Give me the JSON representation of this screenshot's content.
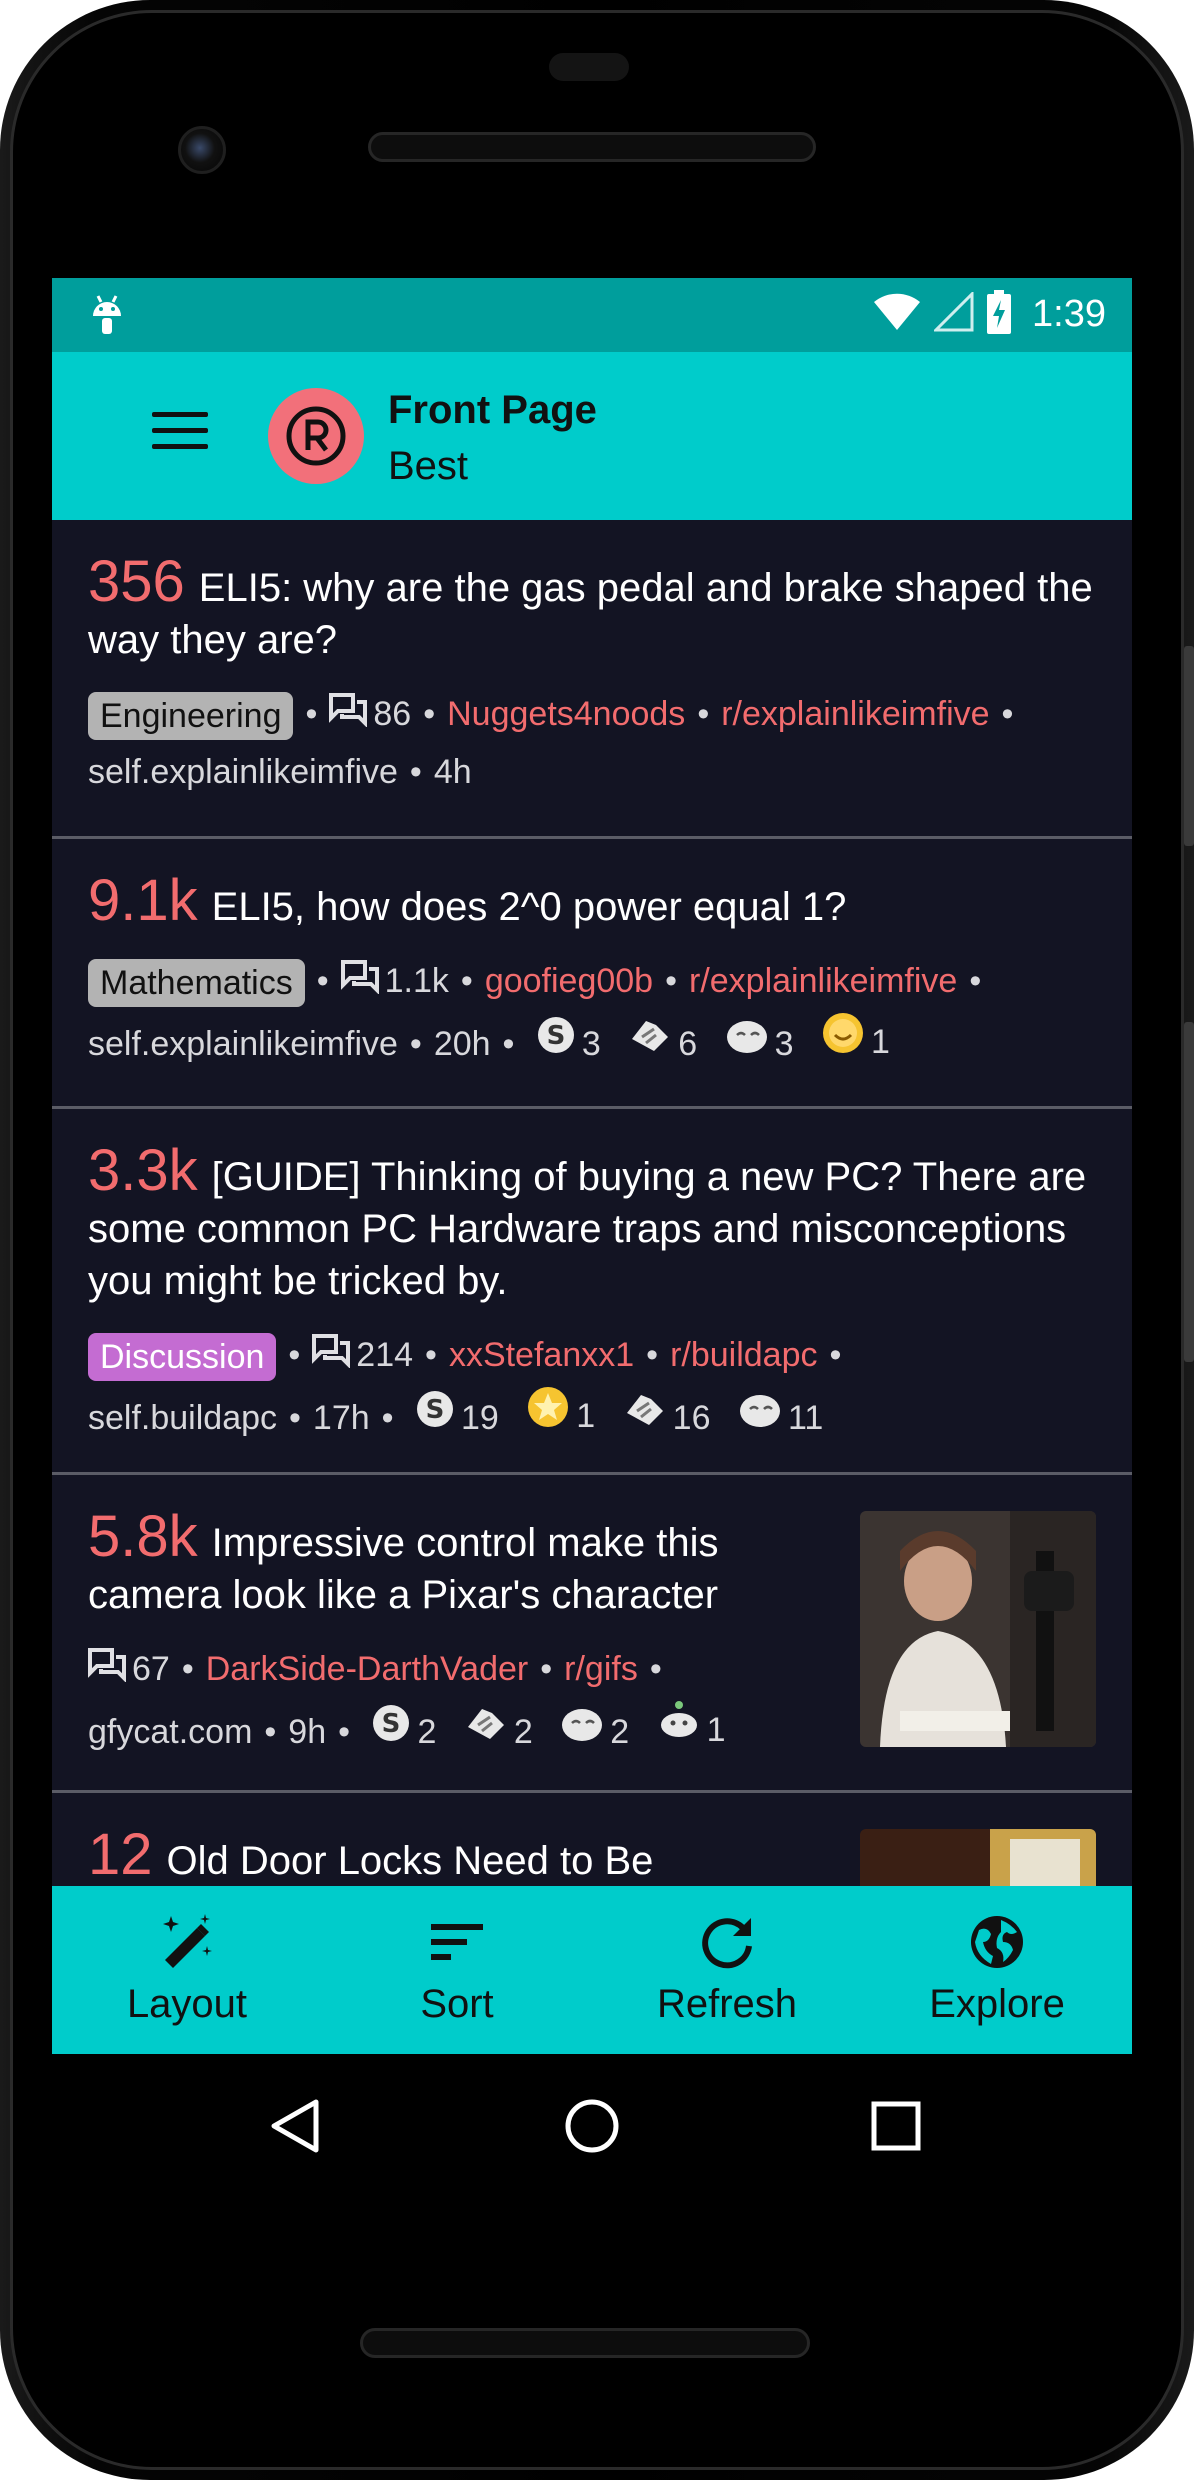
{
  "status_bar": {
    "time": "1:39"
  },
  "toolbar": {
    "title": "Front Page",
    "subtitle": "Best"
  },
  "posts": [
    {
      "score": "356",
      "title": "ELI5: why are the gas pedal and brake shaped the way they are?",
      "flair": "Engineering",
      "comments": "86",
      "author": "Nuggets4noods",
      "subreddit": "r/explainlikeimfive",
      "domain": "self.explainlikeimfive",
      "age": "4h"
    },
    {
      "score": "9.1k",
      "title": "ELI5, how does 2^0 power equal 1?",
      "flair": "Mathematics",
      "comments": "1.1k",
      "author": "goofieg00b",
      "subreddit": "r/explainlikeimfive",
      "domain": "self.explainlikeimfive",
      "age": "20h",
      "awards": [
        "3",
        "6",
        "3",
        "1"
      ]
    },
    {
      "score": "3.3k",
      "title": "[GUIDE] Thinking of buying a new PC? There are some common PC Hardware traps and misconceptions you might be tricked by.",
      "flair": "Discussion",
      "comments": "214",
      "author": "xxStefanxx1",
      "subreddit": "r/buildapc",
      "domain": "self.buildapc",
      "age": "17h",
      "awards": [
        "19",
        "1",
        "16",
        "11"
      ]
    },
    {
      "score": "5.8k",
      "title": "Impressive control make this camera look like a Pixar's character",
      "comments": "67",
      "author": "DarkSide-DarthVader",
      "subreddit": "r/gifs",
      "domain": "gfycat.com",
      "age": "9h",
      "awards": [
        "2",
        "2",
        "2",
        "1"
      ]
    },
    {
      "score": "12",
      "title": "Old Door Locks Need to Be"
    }
  ],
  "bottom_bar": {
    "layout": "Layout",
    "sort": "Sort",
    "refresh": "Refresh",
    "explore": "Explore"
  },
  "colors": {
    "accent": "#00cccb",
    "status_bar": "#009e9c",
    "background": "#131423",
    "score": "#f26c6e"
  },
  "icons": {
    "menu": "hamburger-icon",
    "comments": "comments-icon",
    "layout": "magic-wand-icon",
    "sort": "sort-icon",
    "refresh": "refresh-icon",
    "explore": "globe-icon"
  }
}
